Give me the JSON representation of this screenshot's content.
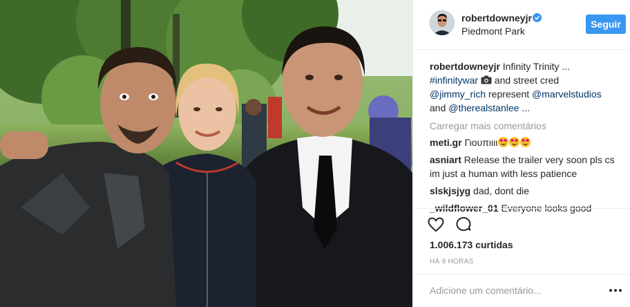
{
  "post": {
    "author": {
      "username": "robertdowneyjr",
      "verified": true,
      "location": "Piedmont Park",
      "avatar_icon": "profile-avatar"
    },
    "follow_label": "Seguir",
    "photo": {
      "description_icon": "photo"
    },
    "caption": {
      "username": "robertdowneyjr",
      "text_1": " Infinity Trinity ...",
      "hashtag": "#infinitywar",
      "emoji_icon": "camera-emoji",
      "text_2": " and street cred",
      "mention_1": "@jimmy_rich",
      "text_3": " represent ",
      "mention_2": "@marvelstudios",
      "text_4": "and ",
      "mention_3": "@therealstanlee",
      "text_5": " ..."
    },
    "load_more_label": "Carregar mais comentários",
    "comments": [
      {
        "username": "meti.gr",
        "text": " Γιουπιιιι",
        "emoji_icon": "heart-eyes-emoji"
      },
      {
        "username": "asniart",
        "text": " Release the trailer very soon pls cs im just a human with less patience"
      },
      {
        "username": "slskjsjyg",
        "text": " dad, dont die"
      },
      {
        "username": "_wildflower_01",
        "text": " Everyone looks good"
      }
    ],
    "likes": "1.006.173 curtidas",
    "timestamp": "Há 9 horas",
    "add_comment_placeholder": "Adicione um comentário...",
    "colors": {
      "accent": "#3897f0",
      "link": "#003569",
      "muted": "#999999",
      "text": "#262626"
    }
  }
}
